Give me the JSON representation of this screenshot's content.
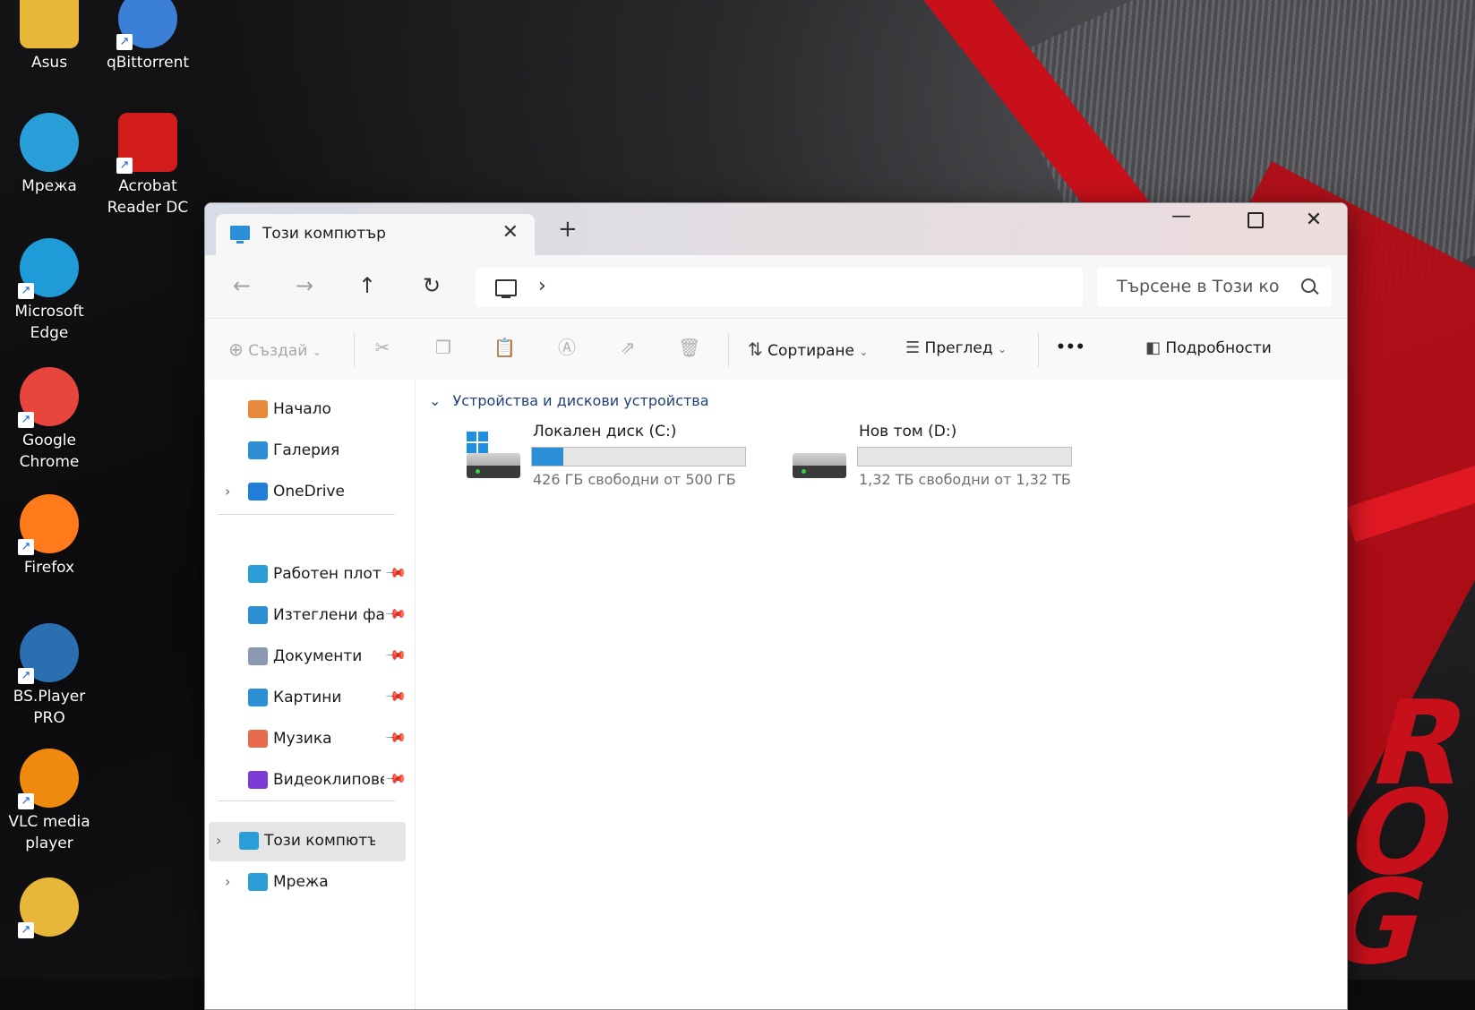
{
  "desktop": {
    "icons": [
      {
        "label": "Asus",
        "icon": "user-folder-icon",
        "color": "#e8b73a"
      },
      {
        "label": "qBittorrent",
        "icon": "qbittorrent-icon",
        "color": "#3b7fd6"
      },
      {
        "label": "Мрежа",
        "icon": "network-icon",
        "color": "#2a9ed8"
      },
      {
        "label": "Acrobat Reader DC",
        "icon": "acrobat-icon",
        "color": "#d21b1b"
      },
      {
        "label": "Microsoft Edge",
        "icon": "edge-icon",
        "color": "#1f9bd8"
      },
      {
        "label": "Google Chrome",
        "icon": "chrome-icon",
        "color": "#e8453c"
      },
      {
        "label": "Firefox",
        "icon": "firefox-icon",
        "color": "#ff7a1a"
      },
      {
        "label": "BS.Player PRO",
        "icon": "bsplayer-icon",
        "color": "#2a6fb0"
      },
      {
        "label": "VLC media player",
        "icon": "vlc-icon",
        "color": "#f08a0e"
      },
      {
        "label": "",
        "icon": "winamp-icon",
        "color": "#e8b73a"
      }
    ]
  },
  "window": {
    "tab_title": "Този компютър",
    "new_tab": "+",
    "search_placeholder": "Търсене в Този ко",
    "address_chevron": "›"
  },
  "commandbar": {
    "create": "Създай",
    "sort": "Сортиране",
    "view": "Преглед",
    "more": "•••",
    "details": "Подробности"
  },
  "sidebar": {
    "items": [
      {
        "label": "Начало",
        "icon": "home-icon",
        "color": "#e8893a"
      },
      {
        "label": "Галерия",
        "icon": "gallery-icon",
        "color": "#2a8fd6"
      },
      {
        "label": "OneDrive",
        "icon": "onedrive-icon",
        "color": "#1f7fd8"
      }
    ],
    "pinned": [
      {
        "label": "Работен плот",
        "icon": "desktop-icon",
        "color": "#2a9ed8"
      },
      {
        "label": "Изтеглени файлове",
        "icon": "downloads-icon",
        "color": "#2a8fd6"
      },
      {
        "label": "Документи",
        "icon": "documents-icon",
        "color": "#8a9ab0"
      },
      {
        "label": "Картини",
        "icon": "pictures-icon",
        "color": "#2a8fd6"
      },
      {
        "label": "Музика",
        "icon": "music-icon",
        "color": "#e86a4a"
      },
      {
        "label": "Видеоклипове",
        "icon": "videos-icon",
        "color": "#7a3ad8"
      }
    ],
    "bottom": [
      {
        "label": "Този компютър",
        "icon": "this-pc-icon",
        "color": "#2a9ed8"
      },
      {
        "label": "Мрежа",
        "icon": "network-icon",
        "color": "#2a9ed8"
      }
    ]
  },
  "main": {
    "group_label": "Устройства и дискови устройства",
    "drives": [
      {
        "name": "Локален диск (C:)",
        "free_text": "426 ГБ свободни от 500 ГБ",
        "used_fraction": 0.148
      },
      {
        "name": "Нов том (D:)",
        "free_text": "1,32 ТБ свободни от 1,32 ТБ",
        "used_fraction": 0.0
      }
    ]
  }
}
